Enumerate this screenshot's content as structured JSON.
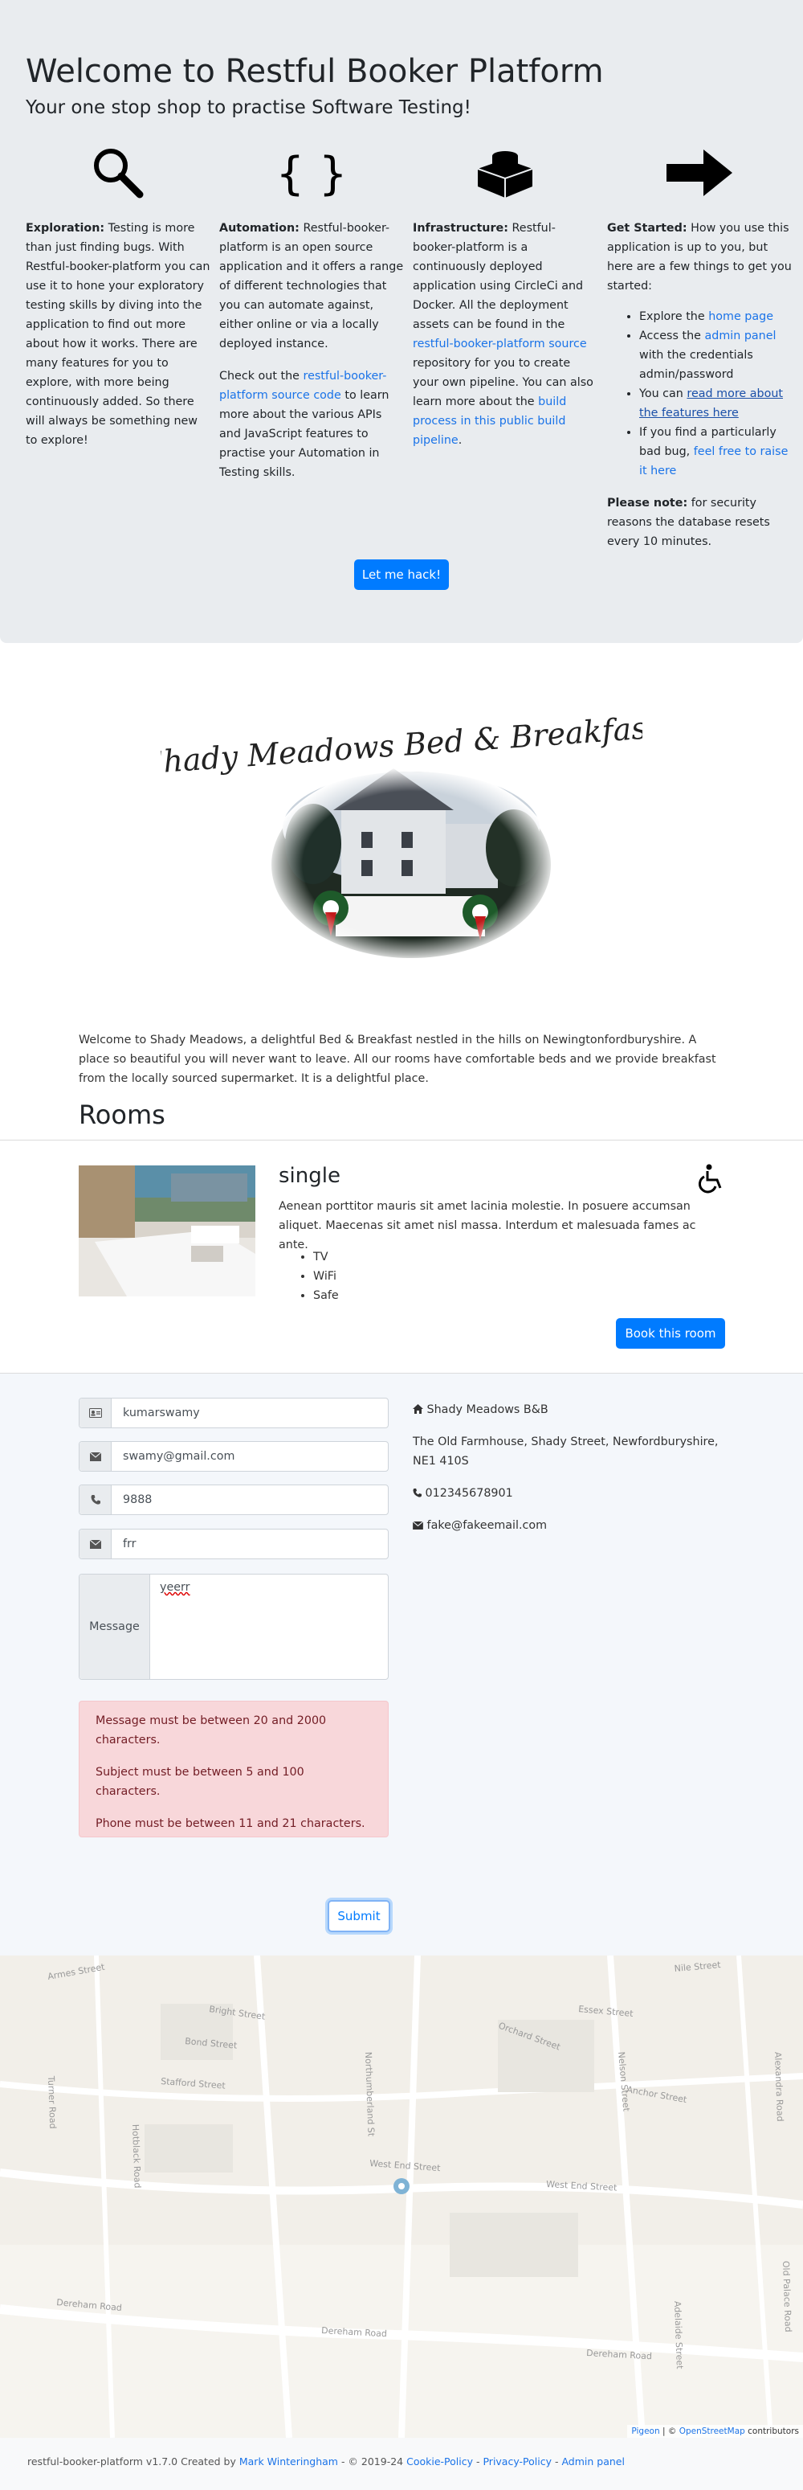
{
  "jumbotron": {
    "title": "Welcome to Restful Booker Platform",
    "subtitle": "Your one stop shop to practise Software Testing!",
    "col1": {
      "lead": "Exploration:",
      "text": " Testing is more than just finding bugs. With Restful-booker-platform you can use it to hone your exploratory testing skills by diving into the application to find out more about how it works. There are many features for you to explore, with more being continuously added. So there will always be something new to explore!"
    },
    "col2": {
      "lead": "Automation:",
      "text": " Restful-booker-platform is an open source application and it offers a range of different technologies that you can automate against, either online or via a locally deployed instance.",
      "p2_pre": "Check out the ",
      "p2_link": "restful-booker-platform source code",
      "p2_post": " to learn more about the various APIs and JavaScript features to practise your Automation in Testing skills."
    },
    "col3": {
      "lead": "Infrastructure:",
      "text": " Restful-booker-platform is a continuously deployed application using CircleCi and Docker. All the deployment assets can be found in the ",
      "link1": "restful-booker-platform source",
      "text2": " repository for you to create your own pipeline. You can also learn more about the ",
      "link2": "build process in this public build pipeline",
      "text3": "."
    },
    "col4": {
      "lead": "Get Started:",
      "text": " How you use this application is up to you, but here are a few things to get you started:",
      "li1_pre": "Explore the ",
      "li1_link": "home page",
      "li2_pre": "Access the ",
      "li2_link": "admin panel",
      "li2_post": " with the credentials admin/password",
      "li3_pre": "You can ",
      "li3_link": "read more about the features here",
      "li4_pre": "If you find a particularly bad bug, ",
      "li4_link": "feel free to raise it here",
      "note_lead": "Please note:",
      "note_text": " for security reasons the database resets every 10 minutes."
    },
    "hack_button": "Let me hack!"
  },
  "hotel": {
    "logo_text": "Shady Meadows Bed & Breakfast",
    "description": "Welcome to Shady Meadows, a delightful Bed & Breakfast nestled in the hills on Newingtonfordburyshire. A place so beautiful you will never want to leave. All our rooms have comfortable beds and we provide breakfast from the locally sourced supermarket. It is a delightful place."
  },
  "rooms": {
    "heading": "Rooms",
    "items": [
      {
        "type": "single",
        "description": "Aenean porttitor mauris sit amet lacinia molestie. In posuere accumsan aliquet. Maecenas sit amet nisl massa. Interdum et malesuada fames ac ante.",
        "features": [
          "TV",
          "WiFi",
          "Safe"
        ],
        "book_label": "Book this room"
      }
    ]
  },
  "contact": {
    "name": "kumarswamy",
    "email": "swamy@gmail.com",
    "phone": "9888",
    "subject": "frr",
    "message_label": "Message",
    "message": "yeerr",
    "errors": [
      "Message must be between 20 and 2000 characters.",
      "Subject must be between 5 and 100 characters.",
      "Phone must be between 11 and 21 characters."
    ],
    "submit_label": "Submit",
    "info": {
      "name": "Shady Meadows B&B",
      "address": "The Old Farmhouse, Shady Street, Newfordburyshire, NE1 410S",
      "phone": "012345678901",
      "email": "fake@fakeemail.com"
    }
  },
  "map": {
    "attr_link1": "Pigeon",
    "attr_sep": " | © ",
    "attr_link2": "OpenStreetMap",
    "attr_post": " contributors",
    "streets": [
      "Bright Street",
      "Dereham Road",
      "Dereham Road",
      "West End Street",
      "West End Street",
      "Dereham Road",
      "Nelson Street",
      "Northumberland St",
      "Armes Street",
      "Stafford Street",
      "Hotblack Road",
      "Bond Street",
      "Turner Road",
      "Old Palace Road",
      "Adelaide Street",
      "Orchard Street",
      "Essex Street",
      "Nile Street",
      "Alexandra Road",
      "Anchor Street"
    ]
  },
  "footer": {
    "pre": "restful-booker-platform v1.7.0 Created by ",
    "author": "Mark Winteringham",
    "mid": " - © 2019-24 ",
    "cookie": "Cookie-Policy",
    "sep1": " - ",
    "privacy": "Privacy-Policy",
    "sep2": " - ",
    "admin": "Admin panel"
  },
  "colors": {
    "primary": "#007bff",
    "jumbotron_bg": "#e9ecef",
    "alert_bg": "#f8d7da",
    "alert_text": "#721c24"
  }
}
